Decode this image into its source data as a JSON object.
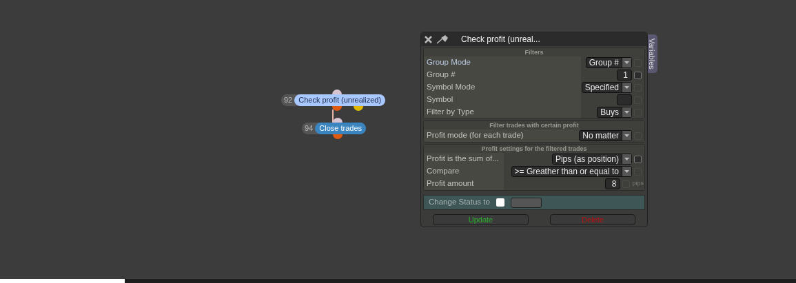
{
  "nodes": [
    {
      "number": "92",
      "label": "Check profit (unrealized)",
      "selected": true
    },
    {
      "number": "94",
      "label": "Close trades",
      "selected": false
    }
  ],
  "panel": {
    "title": "Check profit (unreal...",
    "side_tab": "Variables",
    "sections": [
      {
        "heading": "Filters",
        "rows": [
          {
            "label": "Group Mode",
            "kind": "dropdown",
            "value": "Group #",
            "checkbox": {
              "checked": false,
              "disabled": true
            }
          },
          {
            "label": "Group #",
            "kind": "number",
            "value": "1",
            "checkbox": {
              "checked": false,
              "disabled": false
            }
          },
          {
            "label": "Symbol Mode",
            "kind": "dropdown",
            "value": "Specified",
            "checkbox": {
              "checked": false,
              "disabled": true
            }
          },
          {
            "label": "Symbol",
            "kind": "number",
            "value": "",
            "checkbox": {
              "checked": false,
              "disabled": true
            }
          },
          {
            "label": "Filter by Type",
            "kind": "dropdown",
            "value": "Buys",
            "checkbox": {
              "checked": false,
              "disabled": true
            }
          }
        ]
      },
      {
        "heading": "Filter trades with certain profit",
        "rows": [
          {
            "label": "Profit mode (for each trade)",
            "kind": "dropdown",
            "value": "No matter",
            "checkbox": {
              "checked": false,
              "disabled": true
            }
          }
        ]
      },
      {
        "heading": "Profit settings for the filtered trades",
        "rows": [
          {
            "label": "Profit is the sum of...",
            "kind": "dropdown",
            "value": "Pips (as position)",
            "checkbox": {
              "checked": false,
              "disabled": false
            }
          },
          {
            "label": "Compare",
            "kind": "dropdown",
            "value": ">= Greather than or equal to",
            "checkbox": {
              "checked": false,
              "disabled": true
            }
          },
          {
            "label": "Profit amount",
            "kind": "number",
            "value": "8",
            "checkbox": {
              "checked": false,
              "disabled": true
            },
            "unit": "pips"
          }
        ]
      }
    ],
    "change_status": {
      "label": "Change Status to",
      "checked": false
    },
    "buttons": [
      {
        "label": "Update",
        "kind": "update"
      },
      {
        "label": "Delete",
        "kind": "delete"
      }
    ]
  }
}
